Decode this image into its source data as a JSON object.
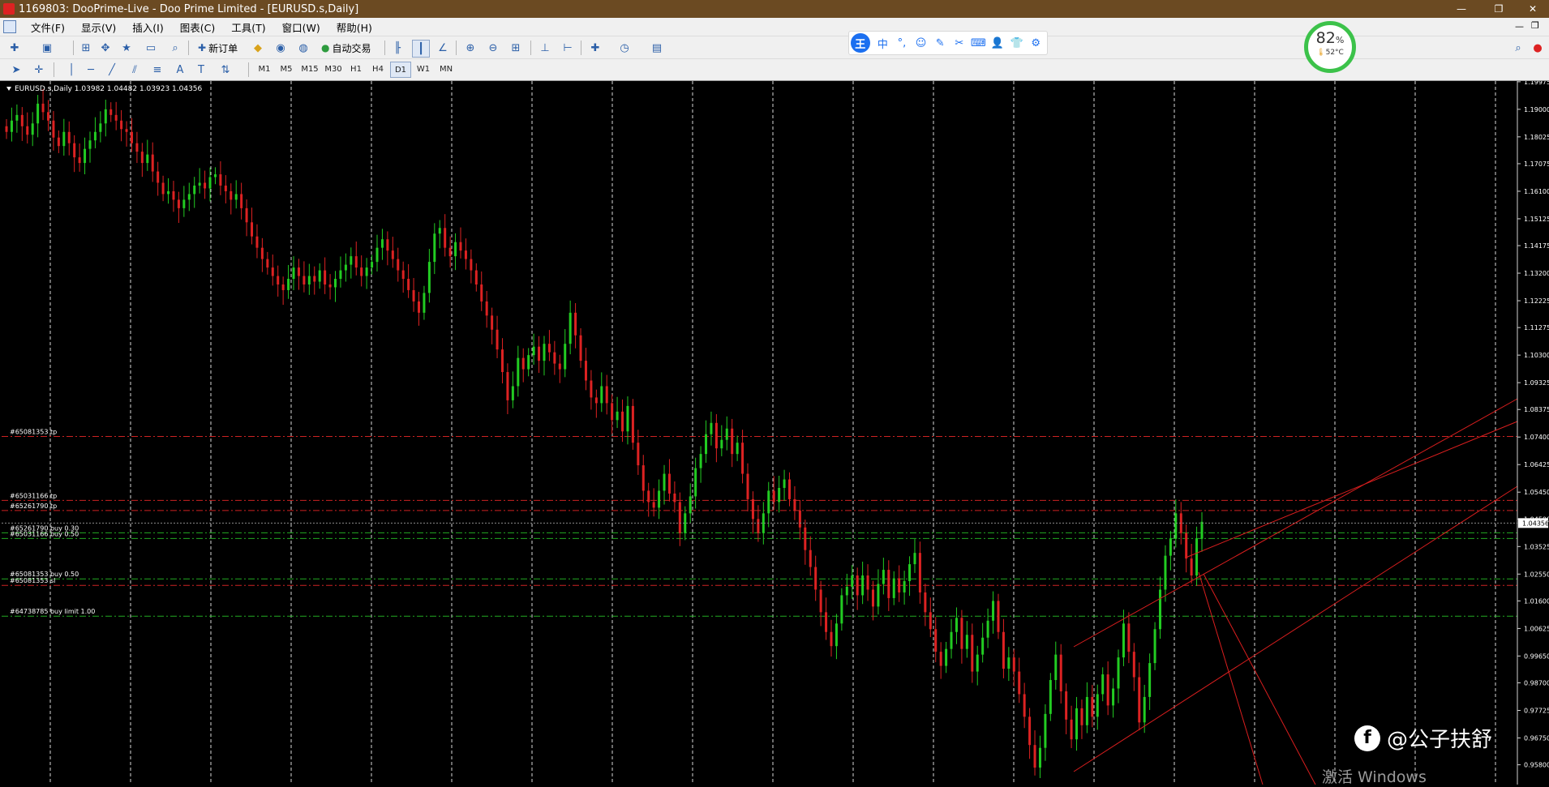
{
  "window": {
    "title": "1169803: DooPrime-Live - Doo Prime Limited - [EURUSD.s,Daily]"
  },
  "menu": [
    "文件(F)",
    "显示(V)",
    "插入(I)",
    "图表(C)",
    "工具(T)",
    "窗口(W)",
    "帮助(H)"
  ],
  "toolbar": {
    "new_order": "新订单",
    "auto_trading": "自动交易"
  },
  "timeframes": [
    "M1",
    "M5",
    "M15",
    "M30",
    "H1",
    "H4",
    "D1",
    "W1",
    "MN"
  ],
  "active_timeframe": "D1",
  "ime": {
    "logo": "王",
    "mode": "中"
  },
  "performance": {
    "cpu_percent": "82",
    "percent_sign": "%",
    "temperature": "52°C",
    "ring_color": "#3cc24a"
  },
  "chart_data": {
    "type": "candlestick",
    "symbol_info": "EURUSD.s,Daily  1.03982 1.04482 1.03923 1.04356",
    "up_color": "#22cc22",
    "down_color": "#dd2222",
    "bg_color": "#000000",
    "current_price": "1.04356",
    "ylim": [
      0.951,
      1.2
    ],
    "ticks": [
      "1.19975",
      "1.19000",
      "1.18025",
      "1.17075",
      "1.16100",
      "1.15125",
      "1.14175",
      "1.13200",
      "1.12225",
      "1.11275",
      "1.10300",
      "1.09325",
      "1.08375",
      "1.07400",
      "1.06425",
      "1.05450",
      "1.04500",
      "1.03525",
      "1.02550",
      "1.01600",
      "1.00625",
      "0.99650",
      "0.98700",
      "0.97725",
      "0.96750",
      "0.95800"
    ],
    "order_lines": [
      {
        "label": "#65081353 tp",
        "price": 1.0742,
        "color": "#cc2222"
      },
      {
        "label": "#65031166 tp",
        "price": 1.0516,
        "color": "#cc2222"
      },
      {
        "label": "#65261790 tp",
        "price": 1.048,
        "color": "#cc2222"
      },
      {
        "label": "#65261790 buy 0.30",
        "price": 1.0401,
        "color": "#22aa22"
      },
      {
        "label": "#65031166 buy 0.50",
        "price": 1.0381,
        "color": "#22aa22"
      },
      {
        "label": "#65081353 buy 0.50",
        "price": 1.0238,
        "color": "#22aa22"
      },
      {
        "label": "#65081353 sl",
        "price": 1.0215,
        "color": "#cc2222"
      },
      {
        "label": "#64738785 buy limit 1.00",
        "price": 1.0106,
        "color": "#22aa22"
      }
    ],
    "close_series": [
      1.182,
      1.186,
      1.188,
      1.184,
      1.181,
      1.185,
      1.192,
      1.189,
      1.186,
      1.18,
      1.177,
      1.182,
      1.178,
      1.173,
      1.171,
      1.176,
      1.179,
      1.182,
      1.185,
      1.19,
      1.188,
      1.186,
      1.183,
      1.182,
      1.178,
      1.175,
      1.171,
      1.174,
      1.168,
      1.164,
      1.16,
      1.161,
      1.158,
      1.155,
      1.158,
      1.16,
      1.163,
      1.164,
      1.162,
      1.166,
      1.167,
      1.163,
      1.161,
      1.158,
      1.16,
      1.155,
      1.15,
      1.145,
      1.141,
      1.137,
      1.134,
      1.131,
      1.128,
      1.126,
      1.13,
      1.134,
      1.131,
      1.128,
      1.131,
      1.129,
      1.133,
      1.128,
      1.127,
      1.13,
      1.133,
      1.135,
      1.138,
      1.134,
      1.131,
      1.134,
      1.136,
      1.141,
      1.144,
      1.14,
      1.137,
      1.133,
      1.13,
      1.126,
      1.122,
      1.118,
      1.125,
      1.136,
      1.146,
      1.148,
      1.141,
      1.138,
      1.143,
      1.14,
      1.137,
      1.133,
      1.128,
      1.122,
      1.117,
      1.112,
      1.105,
      1.097,
      1.087,
      1.092,
      1.102,
      1.098,
      1.103,
      1.106,
      1.101,
      1.107,
      1.104,
      1.1,
      1.098,
      1.107,
      1.118,
      1.11,
      1.101,
      1.094,
      1.088,
      1.086,
      1.092,
      1.086,
      1.08,
      1.083,
      1.076,
      1.085,
      1.072,
      1.064,
      1.055,
      1.051,
      1.049,
      1.055,
      1.061,
      1.054,
      1.051,
      1.04,
      1.047,
      1.053,
      1.063,
      1.068,
      1.075,
      1.079,
      1.07,
      1.073,
      1.077,
      1.068,
      1.072,
      1.061,
      1.052,
      1.045,
      1.04,
      1.047,
      1.055,
      1.051,
      1.056,
      1.059,
      1.052,
      1.048,
      1.042,
      1.034,
      1.028,
      1.02,
      1.012,
      1.005,
      1.0,
      1.008,
      1.018,
      1.021,
      1.025,
      1.018,
      1.025,
      1.02,
      1.014,
      1.022,
      1.027,
      1.017,
      1.024,
      1.019,
      1.023,
      1.029,
      1.033,
      1.019,
      1.012,
      1.006,
      0.998,
      0.993,
      0.999,
      1.005,
      1.01,
      0.999,
      1.004,
      0.991,
      0.997,
      1.003,
      1.009,
      1.016,
      1.005,
      0.992,
      0.996,
      0.991,
      0.983,
      0.975,
      0.965,
      0.957,
      0.964,
      0.976,
      0.988,
      0.997,
      0.984,
      0.974,
      0.967,
      0.978,
      0.972,
      0.982,
      0.975,
      0.983,
      0.99,
      0.979,
      0.985,
      0.996,
      1.008,
      0.998,
      0.989,
      0.973,
      0.982,
      0.994,
      1.006,
      1.02,
      1.032,
      1.038,
      1.047,
      1.04,
      1.031,
      1.025,
      1.038,
      1.044
    ]
  },
  "watermark": {
    "text": "@公子扶舒",
    "logo": "f"
  },
  "activation_notice": "激活 Windows"
}
